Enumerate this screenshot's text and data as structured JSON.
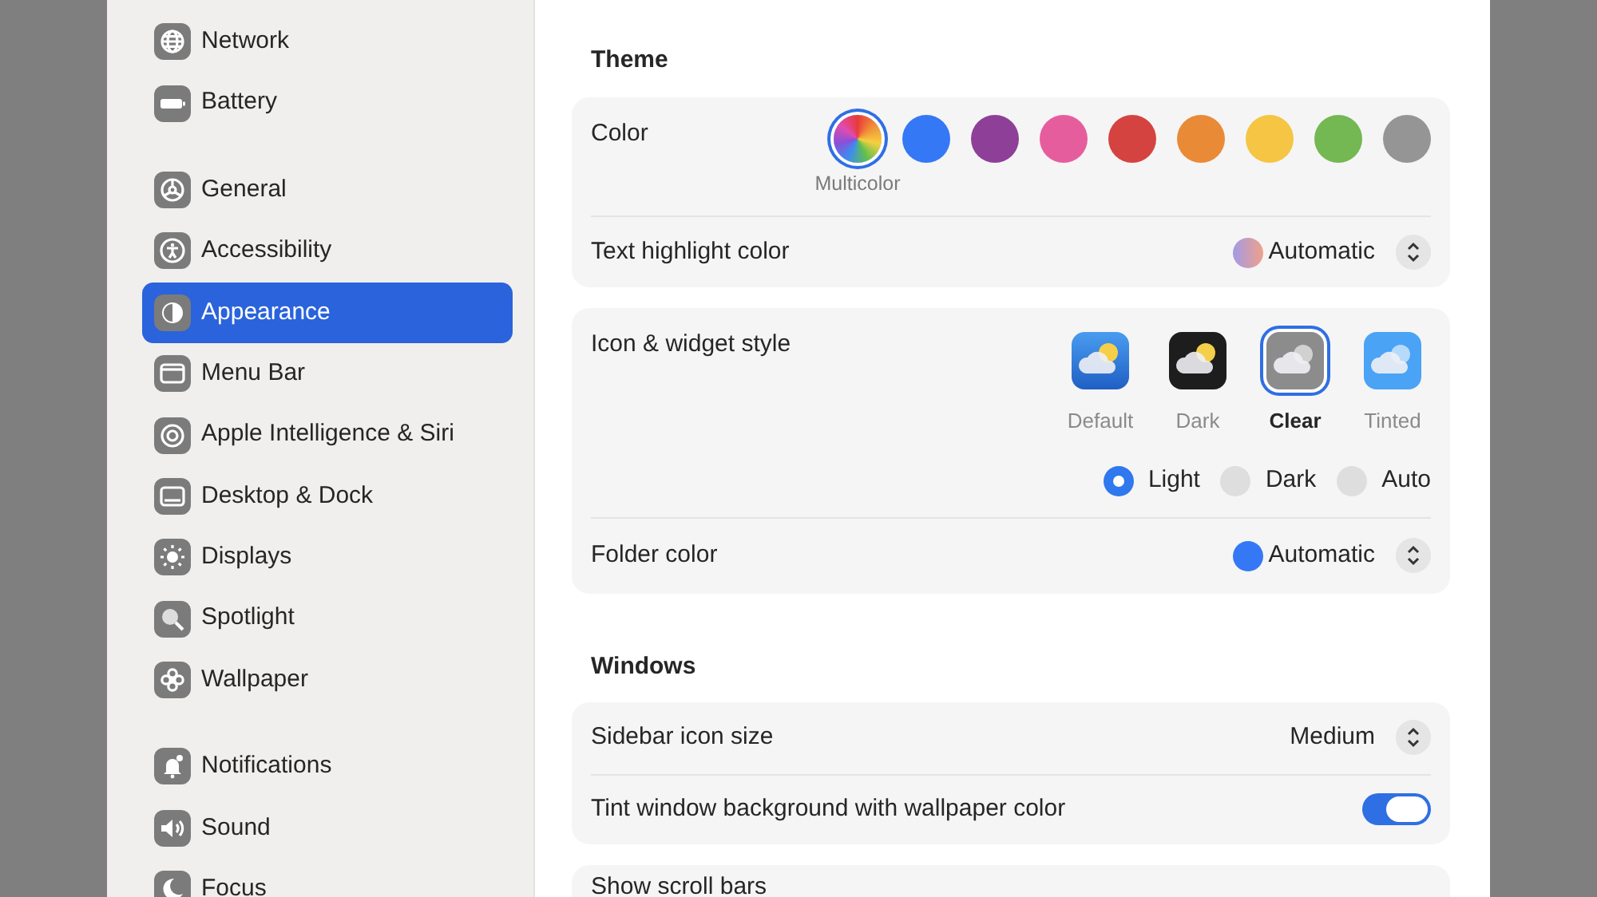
{
  "sidebar": {
    "groups": [
      {
        "items": [
          {
            "label": "Network",
            "selected": false
          },
          {
            "label": "Battery",
            "selected": false
          }
        ]
      },
      {
        "items": [
          {
            "label": "General",
            "selected": false
          },
          {
            "label": "Accessibility",
            "selected": false
          },
          {
            "label": "Appearance",
            "selected": true
          },
          {
            "label": "Menu Bar",
            "selected": false
          },
          {
            "label": "Apple Intelligence & Siri",
            "selected": false
          },
          {
            "label": "Desktop & Dock",
            "selected": false
          },
          {
            "label": "Displays",
            "selected": false
          },
          {
            "label": "Spotlight",
            "selected": false
          },
          {
            "label": "Wallpaper",
            "selected": false
          }
        ]
      },
      {
        "items": [
          {
            "label": "Notifications",
            "selected": false
          },
          {
            "label": "Sound",
            "selected": false
          },
          {
            "label": "Focus",
            "selected": false
          }
        ]
      }
    ]
  },
  "theme": {
    "title": "Theme",
    "color_label": "Color",
    "colors": [
      {
        "kind": "multicolor",
        "label": "Multicolor",
        "selected": true
      },
      {
        "kind": "solid",
        "color": "#3478f6",
        "selected": false
      },
      {
        "kind": "solid",
        "color": "#8e3f97",
        "selected": false
      },
      {
        "kind": "solid",
        "color": "#e65d9e",
        "selected": false
      },
      {
        "kind": "solid",
        "color": "#d54341",
        "selected": false
      },
      {
        "kind": "solid",
        "color": "#e98a37",
        "selected": false
      },
      {
        "kind": "solid",
        "color": "#f5c543",
        "selected": false
      },
      {
        "kind": "solid",
        "color": "#73b852",
        "selected": false
      },
      {
        "kind": "solid",
        "color": "#959595",
        "selected": false
      }
    ],
    "highlight": {
      "label": "Text highlight color",
      "value": "Automatic"
    },
    "icon_style_label": "Icon & widget style",
    "icon_styles": [
      {
        "label": "Default",
        "selected": false
      },
      {
        "label": "Dark",
        "selected": false
      },
      {
        "label": "Clear",
        "selected": true
      },
      {
        "label": "Tinted",
        "selected": false
      }
    ],
    "modes": [
      {
        "label": "Light",
        "selected": true
      },
      {
        "label": "Dark",
        "selected": false
      },
      {
        "label": "Auto",
        "selected": false
      }
    ],
    "folder": {
      "label": "Folder color",
      "value": "Automatic"
    }
  },
  "windows": {
    "title": "Windows",
    "rows": [
      {
        "kind": "popup",
        "label": "Sidebar icon size",
        "value": "Medium"
      },
      {
        "kind": "toggle",
        "label": "Tint window background with wallpaper color",
        "on": true
      }
    ],
    "next_row": {
      "label": "Show scroll bars"
    }
  }
}
